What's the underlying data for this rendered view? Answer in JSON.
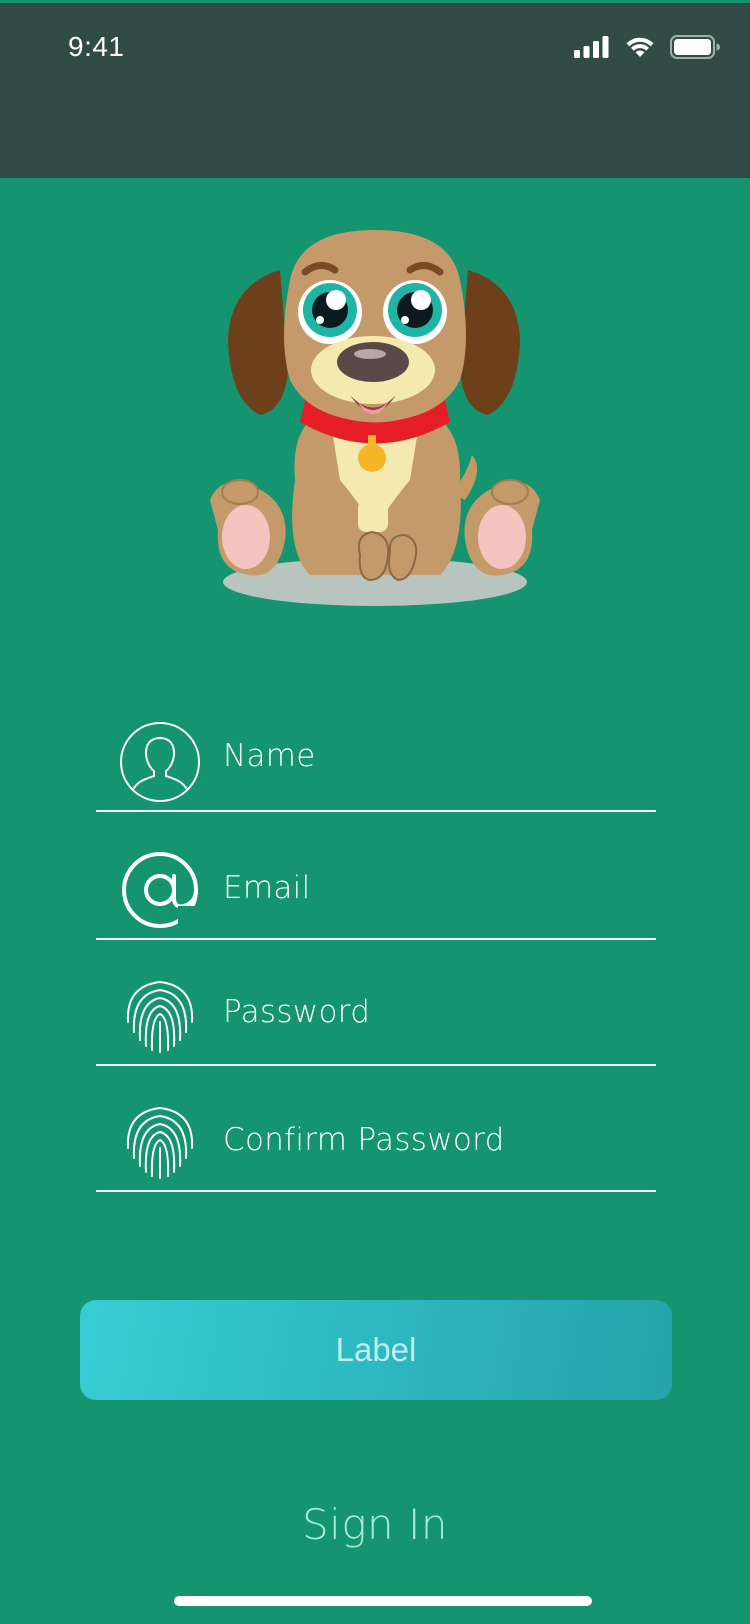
{
  "status_bar": {
    "time": "9:41"
  },
  "form": {
    "fields": [
      {
        "label": "Name",
        "icon": "user-icon"
      },
      {
        "label": "Email",
        "icon": "at-sign-icon"
      },
      {
        "label": "Password",
        "icon": "fingerprint-icon"
      },
      {
        "label": "Confirm Password",
        "icon": "fingerprint-icon"
      }
    ]
  },
  "submit_button": {
    "label": "Label"
  },
  "sign_in": {
    "label": "Sign In"
  },
  "colors": {
    "background": "#15956f",
    "status_bar": "#304c44",
    "button_gradient_start": "#37cdd4",
    "button_gradient_end": "#26a3aa",
    "sign_in_text": "#a9ecd8"
  }
}
